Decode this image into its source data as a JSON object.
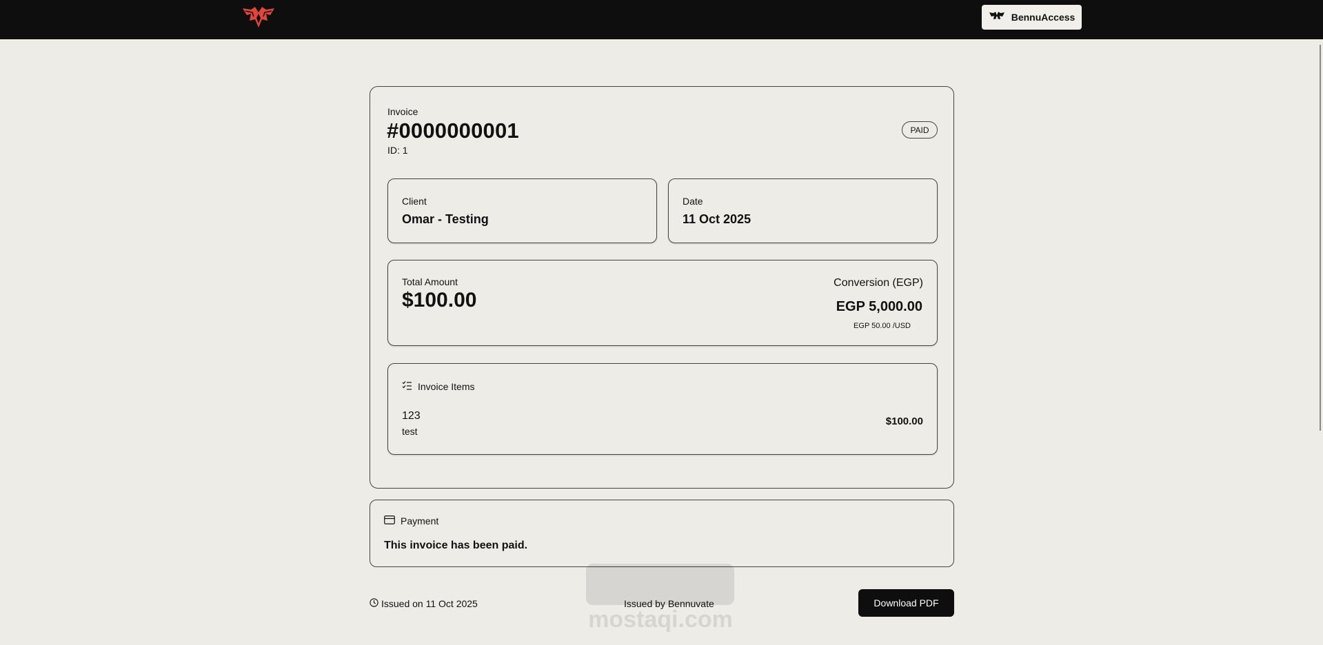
{
  "header": {
    "logo_icon": "phoenix-logo-icon",
    "access_button_label": "BennuAccess",
    "access_button_icon": "phoenix-mark-icon",
    "colors": {
      "bar": "#0e0e0e",
      "logo": "#e2463a"
    }
  },
  "invoice": {
    "label": "Invoice",
    "number": "#0000000001",
    "id_text": "ID: 1",
    "status": "PAID"
  },
  "client": {
    "label": "Client",
    "value": "Omar - Testing"
  },
  "date": {
    "label": "Date",
    "value": "11 Oct 2025"
  },
  "amount": {
    "label": "Total Amount",
    "value": "$100.00",
    "conversion_label": "Conversion (EGP)",
    "conversion_value": "EGP 5,000.00",
    "rate": "EGP 50.00 /USD"
  },
  "items": {
    "title": "Invoice Items",
    "icon": "list-check-icon",
    "rows": [
      {
        "name": "123",
        "description": "test",
        "price": "$100.00"
      }
    ]
  },
  "payment": {
    "title": "Payment",
    "icon": "credit-card-icon",
    "message": "This invoice has been paid."
  },
  "footer": {
    "issued_on": "Issued on 11 Oct 2025",
    "issued_by": "Issued by Bennuvate",
    "download_label": "Download PDF",
    "clock_icon": "clock-icon"
  },
  "watermark": {
    "text": "mostaqi.com"
  }
}
